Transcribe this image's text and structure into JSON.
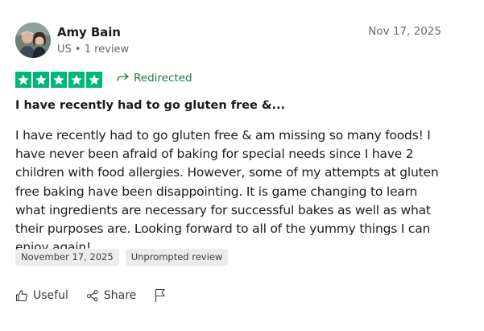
{
  "reviewer": {
    "name": "Amy Bain",
    "meta": "US • 1 review"
  },
  "review": {
    "date_top": "Nov 17, 2025",
    "rating": 5,
    "redirected_label": "Redirected",
    "title": "I have recently had to go gluten free &...",
    "body": "I have recently had to go gluten free & am missing so many foods! I have never been afraid of baking for special needs since I have 2 children with food allergies. However, some of my attempts at gluten free baking have been disappointing. It is game changing to learn what ingredients are necessary for successful bakes as well as what their purposes are. Looking forward to all of the yummy things I can enjoy again!",
    "date_chip": "November 17, 2025",
    "type_chip": "Unprompted review"
  },
  "actions": {
    "useful_label": "Useful",
    "share_label": "Share"
  },
  "colors": {
    "star_green": "#00b67a",
    "redirect_green": "#1f7a3d"
  },
  "icons": [
    "avatar-photo",
    "star-icon",
    "redirect-arrow-icon",
    "thumbs-up-icon",
    "share-icon",
    "flag-icon"
  ]
}
